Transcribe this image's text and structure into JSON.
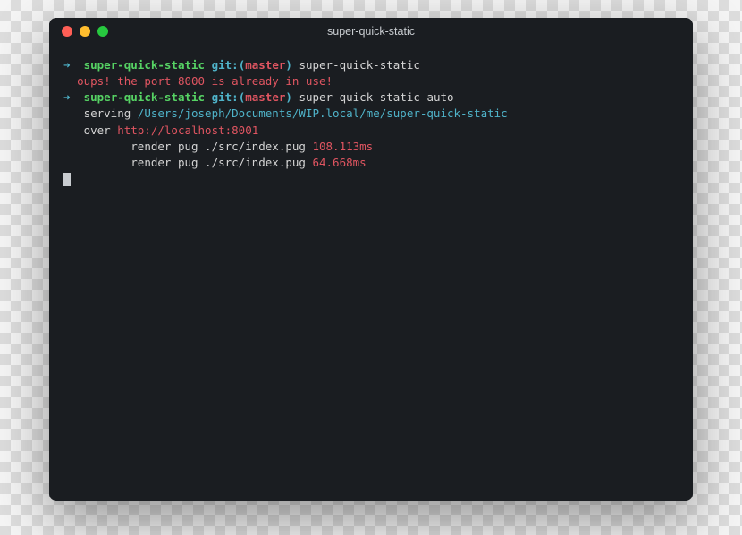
{
  "window": {
    "title": "super-quick-static"
  },
  "prompt": {
    "arrow": "➜",
    "dir": "super-quick-static",
    "git_label": "git:(",
    "branch": "master",
    "git_close": ")"
  },
  "lines": {
    "cmd1": "super-quick-static",
    "error": "oups! the port 8000 is already in use!",
    "cmd2": "super-quick-static auto",
    "serving_label": "serving",
    "serving_path": "/Users/joseph/Documents/WIP.local/me/super-quick-static",
    "over_label": "over",
    "over_url": "http://localhost:8001",
    "render1_text": "render pug ./src/index.pug",
    "render1_ms": "108.113ms",
    "render2_text": "render pug ./src/index.pug",
    "render2_ms": "64.668ms"
  }
}
